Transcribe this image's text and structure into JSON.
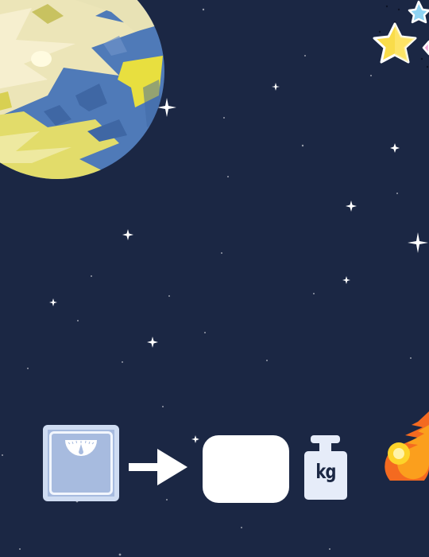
{
  "scene": {
    "background": "#1b2744",
    "icons": {
      "planet": "planet-earth-icon",
      "stars": "stars-cluster-icon",
      "scale": "bathroom-scale-icon",
      "arrow": "right-arrow-icon",
      "weight": "kg-weight-icon",
      "comet": "comet-icon"
    }
  },
  "answer": {
    "value": ""
  },
  "weight": {
    "unit": "kg"
  },
  "colors": {
    "planet_blue": "#4f7ab8",
    "planet_yellow": "#e6df6e",
    "scale": "#a7bbdf",
    "answer_box": "#ffffff",
    "star_yellow": "#f9dc4a",
    "star_blue": "#8fd3f3",
    "comet_orange": "#f46a20"
  }
}
